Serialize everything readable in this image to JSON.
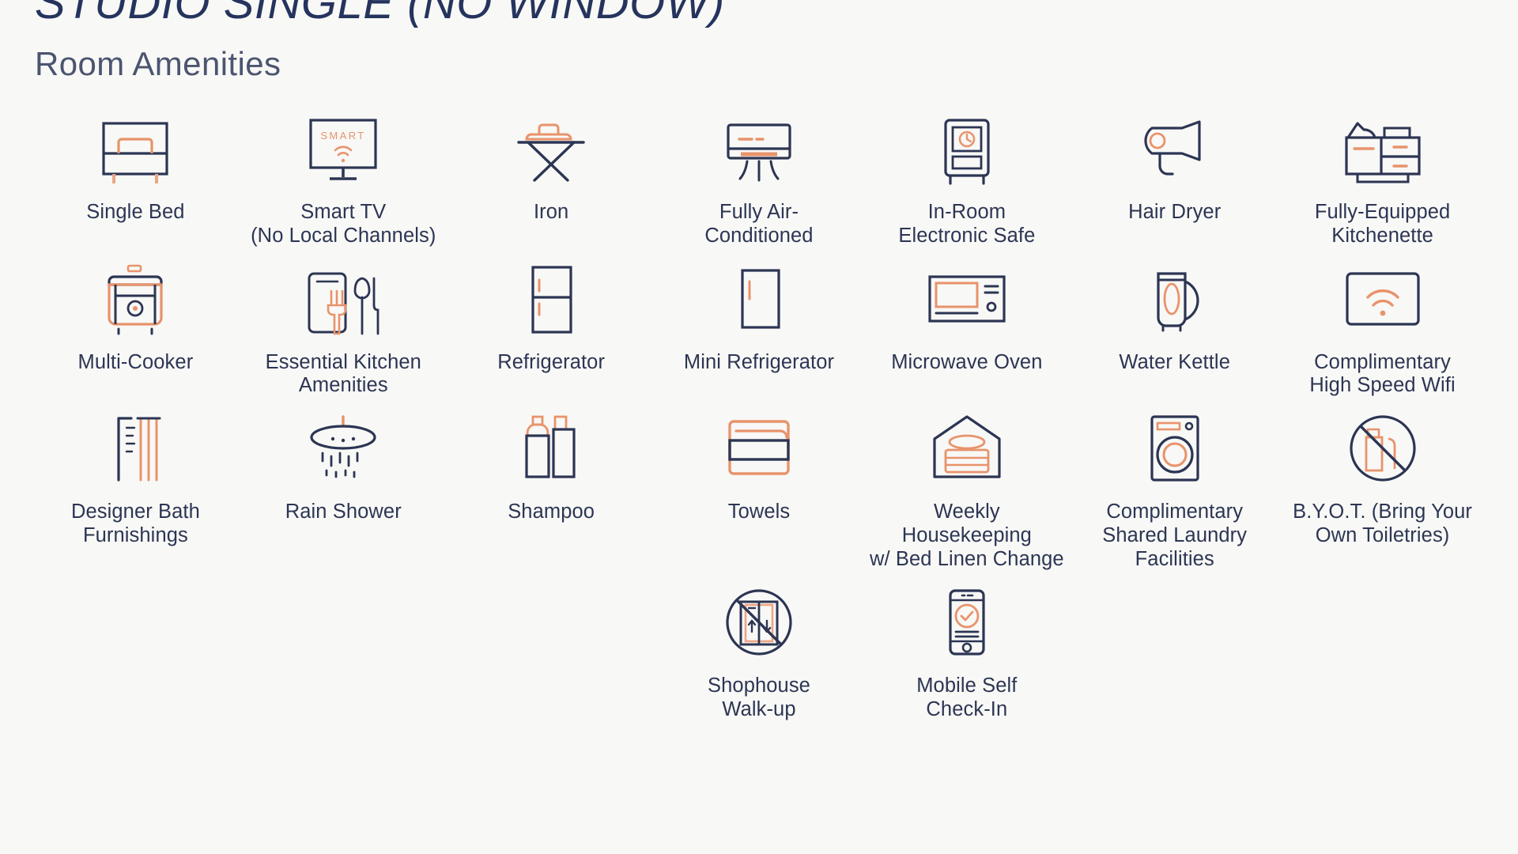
{
  "header": {
    "title": "STUDIO SINGLE (NO WINDOW)",
    "subtitle": "Room Amenities"
  },
  "colors": {
    "background": "#f8f8f6",
    "navy": "#2c3553",
    "navy_title": "#25345e",
    "salmon": "#e8936b",
    "salmon_light": "#eda684",
    "text": "#2c3553"
  },
  "amenities": [
    {
      "label": "Single Bed",
      "icon": "single-bed-icon"
    },
    {
      "label": "Smart TV\n(No Local Channels)",
      "icon": "smart-tv-icon"
    },
    {
      "label": "Iron",
      "icon": "iron-icon"
    },
    {
      "label": "Fully Air-\nConditioned",
      "icon": "air-conditioner-icon"
    },
    {
      "label": "In-Room\nElectronic Safe",
      "icon": "safe-icon"
    },
    {
      "label": "Hair Dryer",
      "icon": "hair-dryer-icon"
    },
    {
      "label": "Fully-Equipped\nKitchenette",
      "icon": "kitchenette-icon"
    },
    {
      "label": "Multi-Cooker",
      "icon": "multi-cooker-icon"
    },
    {
      "label": "Essential Kitchen\nAmenities",
      "icon": "cutlery-icon"
    },
    {
      "label": "Refrigerator",
      "icon": "refrigerator-icon"
    },
    {
      "label": "Mini Refrigerator",
      "icon": "mini-refrigerator-icon"
    },
    {
      "label": "Microwave Oven",
      "icon": "microwave-icon"
    },
    {
      "label": "Water Kettle",
      "icon": "kettle-icon"
    },
    {
      "label": "Complimentary\nHigh Speed Wifi",
      "icon": "wifi-icon"
    },
    {
      "label": "Designer Bath\nFurnishings",
      "icon": "bath-furnishings-icon"
    },
    {
      "label": "Rain Shower",
      "icon": "rain-shower-icon"
    },
    {
      "label": "Shampoo",
      "icon": "shampoo-icon"
    },
    {
      "label": "Towels",
      "icon": "towels-icon"
    },
    {
      "label": "Weekly Housekeeping\nw/ Bed Linen Change",
      "icon": "housekeeping-icon"
    },
    {
      "label": "Complimentary\nShared Laundry\nFacilities",
      "icon": "washing-machine-icon"
    },
    {
      "label": "B.Y.O.T. (Bring Your\nOwn Toiletries)",
      "icon": "no-toiletries-icon"
    },
    {
      "label": "Shophouse\nWalk-up",
      "icon": "no-elevator-icon"
    },
    {
      "label": "Mobile Self\nCheck-In",
      "icon": "mobile-checkin-icon"
    }
  ],
  "icon_text": {
    "smart_tv": "SMART"
  }
}
